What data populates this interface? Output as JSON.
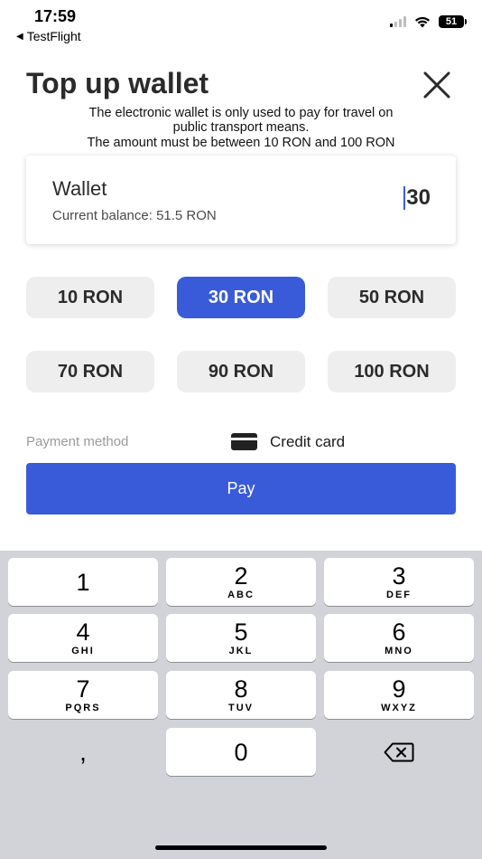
{
  "status_bar": {
    "time": "17:59",
    "back_app": "TestFlight",
    "battery": "51"
  },
  "header": {
    "title": "Top up wallet",
    "info_line1": "The electronic wallet is only used to pay for travel on",
    "info_line2": "public transport means.",
    "info_line3": "The amount must be between 10 RON and 100 RON"
  },
  "wallet": {
    "title": "Wallet",
    "balance": "Current balance: 51.5 RON",
    "amount": "30"
  },
  "presets": [
    {
      "label": "10 RON",
      "selected": false
    },
    {
      "label": "30 RON",
      "selected": true
    },
    {
      "label": "50 RON",
      "selected": false
    },
    {
      "label": "70 RON",
      "selected": false
    },
    {
      "label": "90 RON",
      "selected": false
    },
    {
      "label": "100 RON",
      "selected": false
    }
  ],
  "payment": {
    "label": "Payment method",
    "value": "Credit card",
    "icon": "credit-card-icon"
  },
  "pay_label": "Pay",
  "keypad": [
    {
      "num": "1",
      "letters": ""
    },
    {
      "num": "2",
      "letters": "ABC"
    },
    {
      "num": "3",
      "letters": "DEF"
    },
    {
      "num": "4",
      "letters": "GHI"
    },
    {
      "num": "5",
      "letters": "JKL"
    },
    {
      "num": "6",
      "letters": "MNO"
    },
    {
      "num": "7",
      "letters": "PQRS"
    },
    {
      "num": "8",
      "letters": "TUV"
    },
    {
      "num": "9",
      "letters": "WXYZ"
    },
    {
      "num": ",",
      "letters": ""
    },
    {
      "num": "0",
      "letters": ""
    }
  ],
  "colors": {
    "accent": "#3a5bd9",
    "chip": "#eeeeef",
    "keyboard_bg": "#d1d3d9"
  }
}
